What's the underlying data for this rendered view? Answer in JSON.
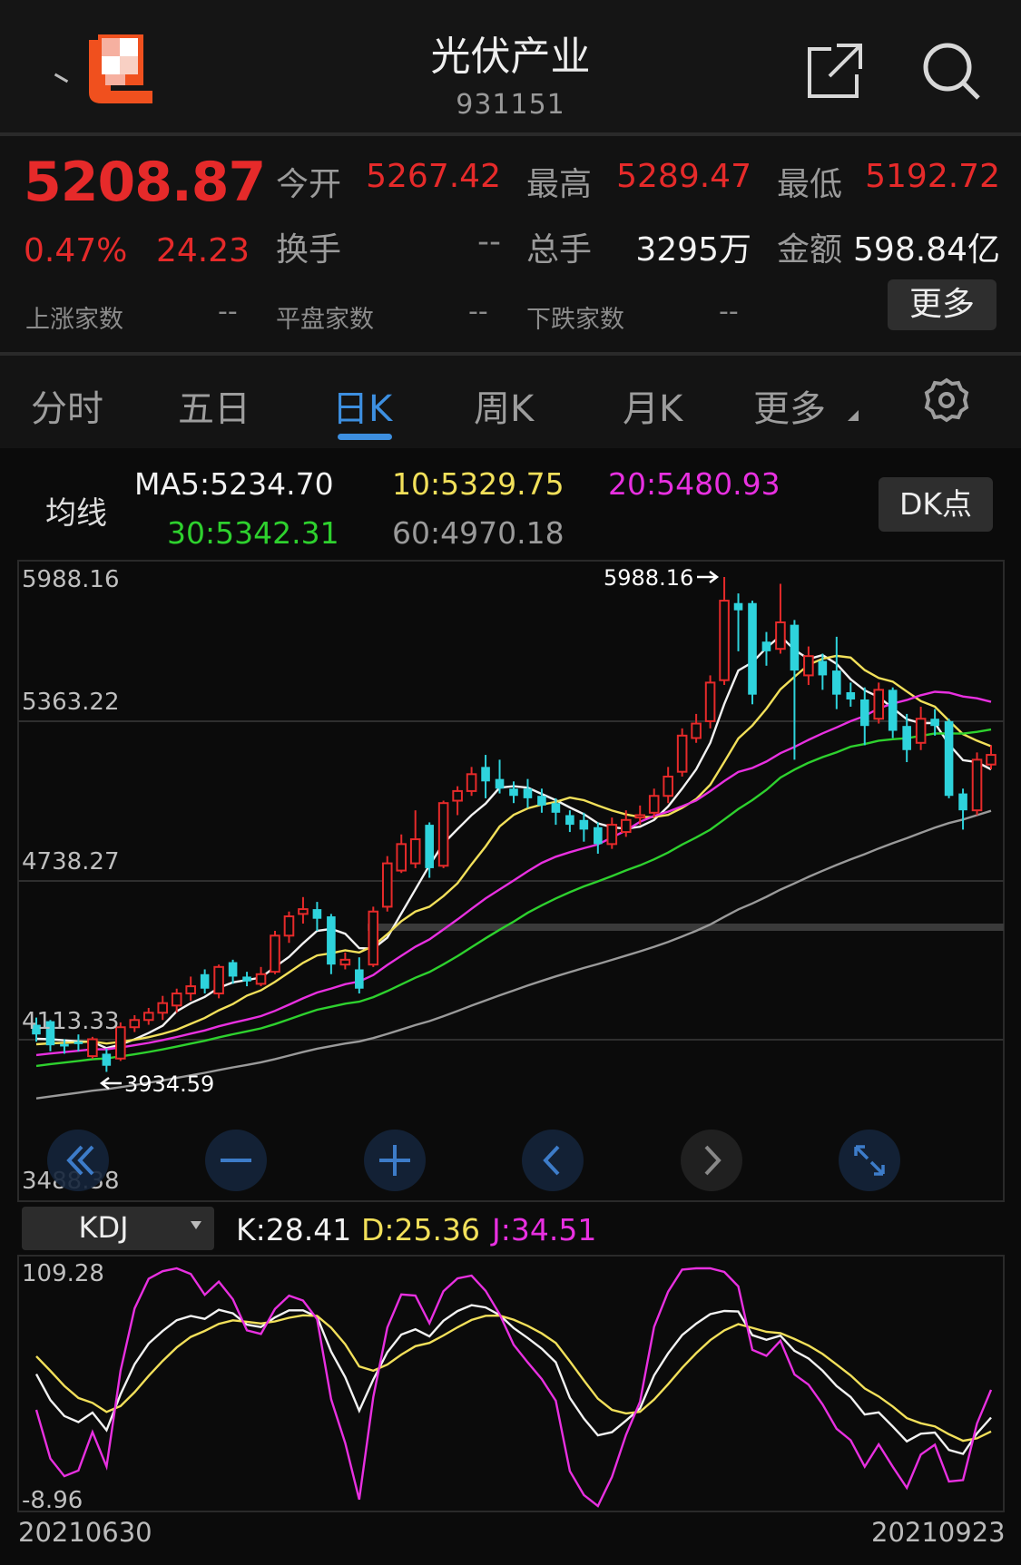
{
  "header": {
    "title": "光伏产业",
    "code": "931151"
  },
  "quote": {
    "price": "5208.87",
    "change_pct": "0.47%",
    "change": "24.23",
    "stats": [
      {
        "label": "今开",
        "value": "5267.42",
        "color": "red"
      },
      {
        "label": "最高",
        "value": "5289.47",
        "color": "red"
      },
      {
        "label": "最低",
        "value": "5192.72",
        "color": "red"
      },
      {
        "label": "换手",
        "value": "--",
        "color": "grey"
      },
      {
        "label": "总手",
        "value": "3295万",
        "color": "white"
      },
      {
        "label": "金额",
        "value": "598.84亿",
        "color": "white"
      }
    ],
    "breadth": [
      {
        "label": "上涨家数",
        "value": "--"
      },
      {
        "label": "平盘家数",
        "value": "--"
      },
      {
        "label": "下跌家数",
        "value": "--"
      }
    ],
    "more_label": "更多"
  },
  "tabs": [
    "分时",
    "五日",
    "日K",
    "周K",
    "月K",
    "更多"
  ],
  "active_tab": "日K",
  "ma_legend": {
    "label": "均线",
    "ma5": "MA5:5234.70",
    "ma10": "10:5329.75",
    "ma20": "20:5480.93",
    "ma30": "30:5342.31",
    "ma60": "60:4970.18",
    "dk_label": "DK点"
  },
  "colors": {
    "up": "#e62a2a",
    "down": "#2ed3dc",
    "ma5": "#f2f2f2",
    "ma10": "#f2e05a",
    "ma20": "#e830e0",
    "ma30": "#2ed12e",
    "ma60": "#9a9a9a",
    "accent": "#3d8fe0"
  },
  "chart_data": [
    {
      "type": "candlestick",
      "y_ticks": [
        "5988.16",
        "5363.22",
        "4738.27",
        "4113.33",
        "3488.38"
      ],
      "ylim": [
        3488.38,
        5988.16
      ],
      "max_label": "5988.16",
      "min_label": "3934.59",
      "x_start": "20210630",
      "x_end": "20210923",
      "candles": [
        [
          4130,
          4090,
          4160,
          4060
        ],
        [
          4145,
          4045,
          4150,
          4020
        ],
        [
          4050,
          4040,
          4070,
          4010
        ],
        [
          4060,
          4050,
          4090,
          4020
        ],
        [
          4000,
          4070,
          4080,
          3990
        ],
        [
          4010,
          3960,
          4030,
          3934.59
        ],
        [
          3990,
          4120,
          4140,
          3980
        ],
        [
          4120,
          4150,
          4170,
          4100
        ],
        [
          4150,
          4180,
          4200,
          4130
        ],
        [
          4180,
          4220,
          4250,
          4150
        ],
        [
          4210,
          4260,
          4280,
          4180
        ],
        [
          4260,
          4290,
          4330,
          4230
        ],
        [
          4340,
          4280,
          4360,
          4260
        ],
        [
          4260,
          4370,
          4380,
          4240
        ],
        [
          4390,
          4330,
          4400,
          4300
        ],
        [
          4330,
          4310,
          4350,
          4290
        ],
        [
          4300,
          4340,
          4370,
          4290
        ],
        [
          4350,
          4500,
          4520,
          4340
        ],
        [
          4500,
          4580,
          4600,
          4470
        ],
        [
          4590,
          4610,
          4660,
          4550
        ],
        [
          4610,
          4570,
          4640,
          4520
        ],
        [
          4580,
          4380,
          4590,
          4340
        ],
        [
          4380,
          4400,
          4430,
          4360
        ],
        [
          4360,
          4280,
          4410,
          4260
        ],
        [
          4380,
          4600,
          4620,
          4370
        ],
        [
          4620,
          4800,
          4830,
          4600
        ],
        [
          4770,
          4880,
          4920,
          4760
        ],
        [
          4800,
          4900,
          5020,
          4780
        ],
        [
          4960,
          4780,
          4970,
          4740
        ],
        [
          4790,
          5050,
          5060,
          4780
        ],
        [
          5060,
          5100,
          5120,
          5000
        ],
        [
          5100,
          5170,
          5200,
          5080
        ],
        [
          5200,
          5140,
          5250,
          5070
        ],
        [
          5150,
          5110,
          5230,
          5090
        ],
        [
          5110,
          5080,
          5140,
          5050
        ],
        [
          5110,
          5070,
          5150,
          5030
        ],
        [
          5080,
          5040,
          5110,
          5010
        ],
        [
          5050,
          5010,
          5070,
          4960
        ],
        [
          5000,
          4960,
          5020,
          4930
        ],
        [
          4980,
          4940,
          5010,
          4890
        ],
        [
          4950,
          4880,
          4970,
          4840
        ],
        [
          4880,
          4960,
          4990,
          4860
        ],
        [
          4930,
          4980,
          5020,
          4910
        ],
        [
          4990,
          5000,
          5040,
          4960
        ],
        [
          5010,
          5080,
          5110,
          4990
        ],
        [
          5080,
          5160,
          5200,
          5050
        ],
        [
          5180,
          5330,
          5360,
          5160
        ],
        [
          5320,
          5380,
          5420,
          5300
        ],
        [
          5390,
          5550,
          5580,
          5360
        ],
        [
          5560,
          5890,
          5988.16,
          5540
        ],
        [
          5880,
          5850,
          5920,
          5680
        ],
        [
          5880,
          5500,
          5890,
          5460
        ],
        [
          5720,
          5680,
          5760,
          5620
        ],
        [
          5690,
          5800,
          5960,
          5670
        ],
        [
          5790,
          5600,
          5810,
          5230
        ],
        [
          5580,
          5660,
          5700,
          5540
        ],
        [
          5640,
          5580,
          5670,
          5520
        ],
        [
          5600,
          5500,
          5740,
          5440
        ],
        [
          5510,
          5480,
          5550,
          5450
        ],
        [
          5480,
          5370,
          5530,
          5290
        ],
        [
          5400,
          5520,
          5550,
          5380
        ],
        [
          5520,
          5350,
          5530,
          5320
        ],
        [
          5370,
          5270,
          5420,
          5220
        ],
        [
          5300,
          5400,
          5450,
          5270
        ],
        [
          5400,
          5370,
          5440,
          5330
        ],
        [
          5390,
          5080,
          5400,
          5070
        ],
        [
          5090,
          5020,
          5110,
          4940
        ],
        [
          5020,
          5230,
          5260,
          5000
        ],
        [
          5210,
          5250,
          5290,
          5190
        ]
      ]
    },
    {
      "type": "line",
      "title": "KDJ",
      "series": [
        {
          "name": "K",
          "value": "K:28.41"
        },
        {
          "name": "D",
          "value": "D:25.36"
        },
        {
          "name": "J",
          "value": "J:34.51"
        }
      ],
      "y_ticks": [
        "109.28",
        "-8.96"
      ],
      "ylim": [
        -8.96,
        109.28
      ]
    }
  ]
}
